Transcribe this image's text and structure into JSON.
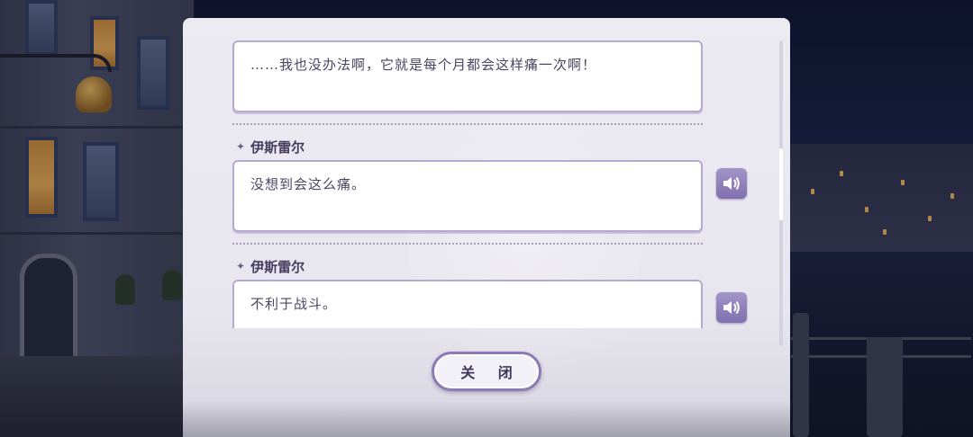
{
  "dialog_log": {
    "entries": [
      {
        "speaker": "",
        "text": "……我也没办法啊，它就是每个月都会这样痛一次啊！",
        "has_voice": false
      },
      {
        "speaker": "伊斯雷尔",
        "text": "没想到会这么痛。",
        "has_voice": true
      },
      {
        "speaker": "伊斯雷尔",
        "text": "不利于战斗。",
        "has_voice": true
      }
    ],
    "close_label": "关 闭"
  },
  "icons": {
    "speaker_marker": "four-point-star-icon",
    "voice_button": "speaker-icon"
  },
  "colors": {
    "panel_bg": "#ecebf1",
    "bubble_border": "#b5a9d1",
    "voice_button": "#8f80bb",
    "text": "#4a4560"
  }
}
